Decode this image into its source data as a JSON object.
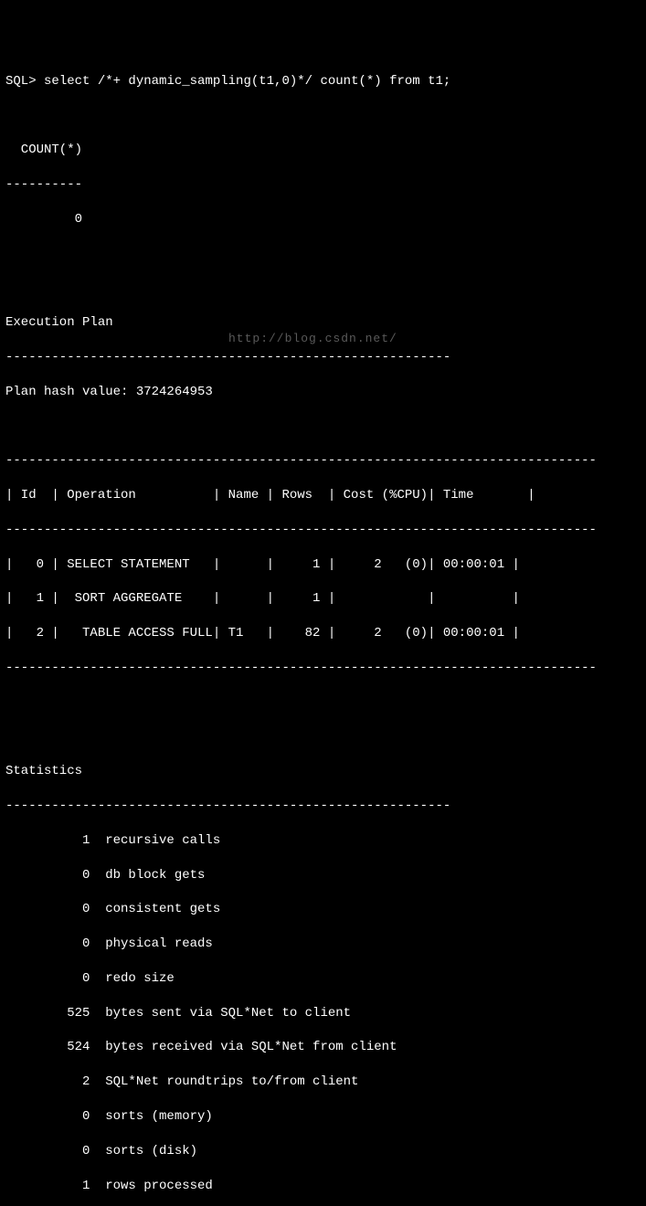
{
  "prompt": {
    "prefix": "SQL> ",
    "command": "select /*+ dynamic_sampling(t1,0)*/ count(*) from t1;"
  },
  "result": {
    "header": "  COUNT(*)",
    "divider": "----------",
    "value": "         0"
  },
  "exec_plan": {
    "title": "Execution Plan",
    "divider": "----------------------------------------------------------",
    "hash_label": "Plan hash value: 3724264953",
    "table_divider": "-----------------------------------------------------------------------------",
    "header": "| Id  | Operation          | Name | Rows  | Cost (%CPU)| Time       |",
    "rows": [
      "|   0 | SELECT STATEMENT   |      |     1 |     2   (0)| 00:00:01 |",
      "|   1 |  SORT AGGREGATE    |      |     1 |            |          |",
      "|   2 |   TABLE ACCESS FULL| T1   |    82 |     2   (0)| 00:00:01 |"
    ]
  },
  "statistics": {
    "title": "Statistics",
    "divider": "----------------------------------------------------------",
    "rows": [
      "          1  recursive calls",
      "          0  db block gets",
      "          0  consistent gets",
      "          0  physical reads",
      "          0  redo size",
      "        525  bytes sent via SQL*Net to client",
      "        524  bytes received via SQL*Net from client",
      "          2  SQL*Net roundtrips to/from client",
      "          0  sorts (memory)",
      "          0  sorts (disk)",
      "          1  rows processed"
    ]
  },
  "watermark": "http://blog.csdn.net/"
}
